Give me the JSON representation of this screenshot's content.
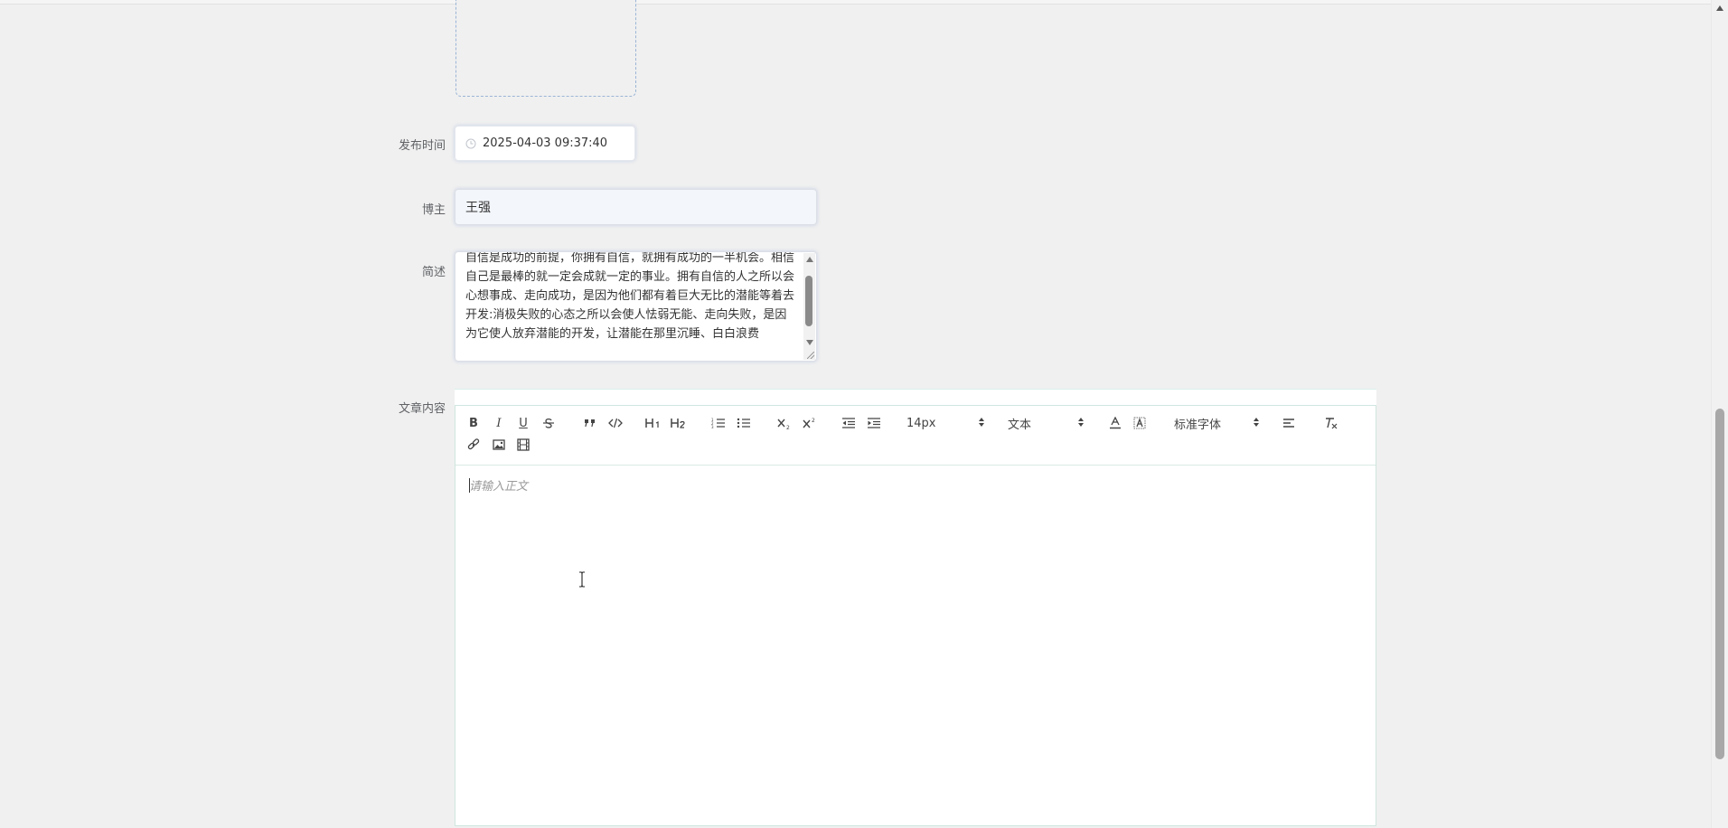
{
  "form": {
    "publish_time_label": "发布时间",
    "publish_time_value": "2025-04-03 09:37:40",
    "blogger_label": "博主",
    "blogger_value": "王强",
    "summary_label": "简述",
    "summary_value": "自信是成功的前提，你拥有自信，就拥有成功的一半机会。相信自己是最棒的就一定会成就一定的事业。拥有自信的人之所以会心想事成、走向成功，是因为他们都有着巨大无比的潜能等着去开发:消极失败的心态之所以会使人怯弱无能、走向失败，是因为它使人放弃潜能的开发，让潜能在那里沉睡、白白浪费",
    "content_label": "文章内容"
  },
  "editor": {
    "font_size": "14px",
    "header_style": "文本",
    "font_family": "标准字体",
    "placeholder": "请输入正文"
  },
  "toolbar_icons": [
    "bold-icon",
    "italic-icon",
    "underline-icon",
    "strike-icon",
    "blockquote-icon",
    "code-block-icon",
    "h1-icon",
    "h2-icon",
    "ordered-list-icon",
    "bullet-list-icon",
    "subscript-icon",
    "superscript-icon",
    "outdent-icon",
    "indent-icon",
    "font-color-icon",
    "background-color-icon",
    "align-icon",
    "clear-format-icon",
    "link-icon",
    "image-icon",
    "video-icon"
  ]
}
